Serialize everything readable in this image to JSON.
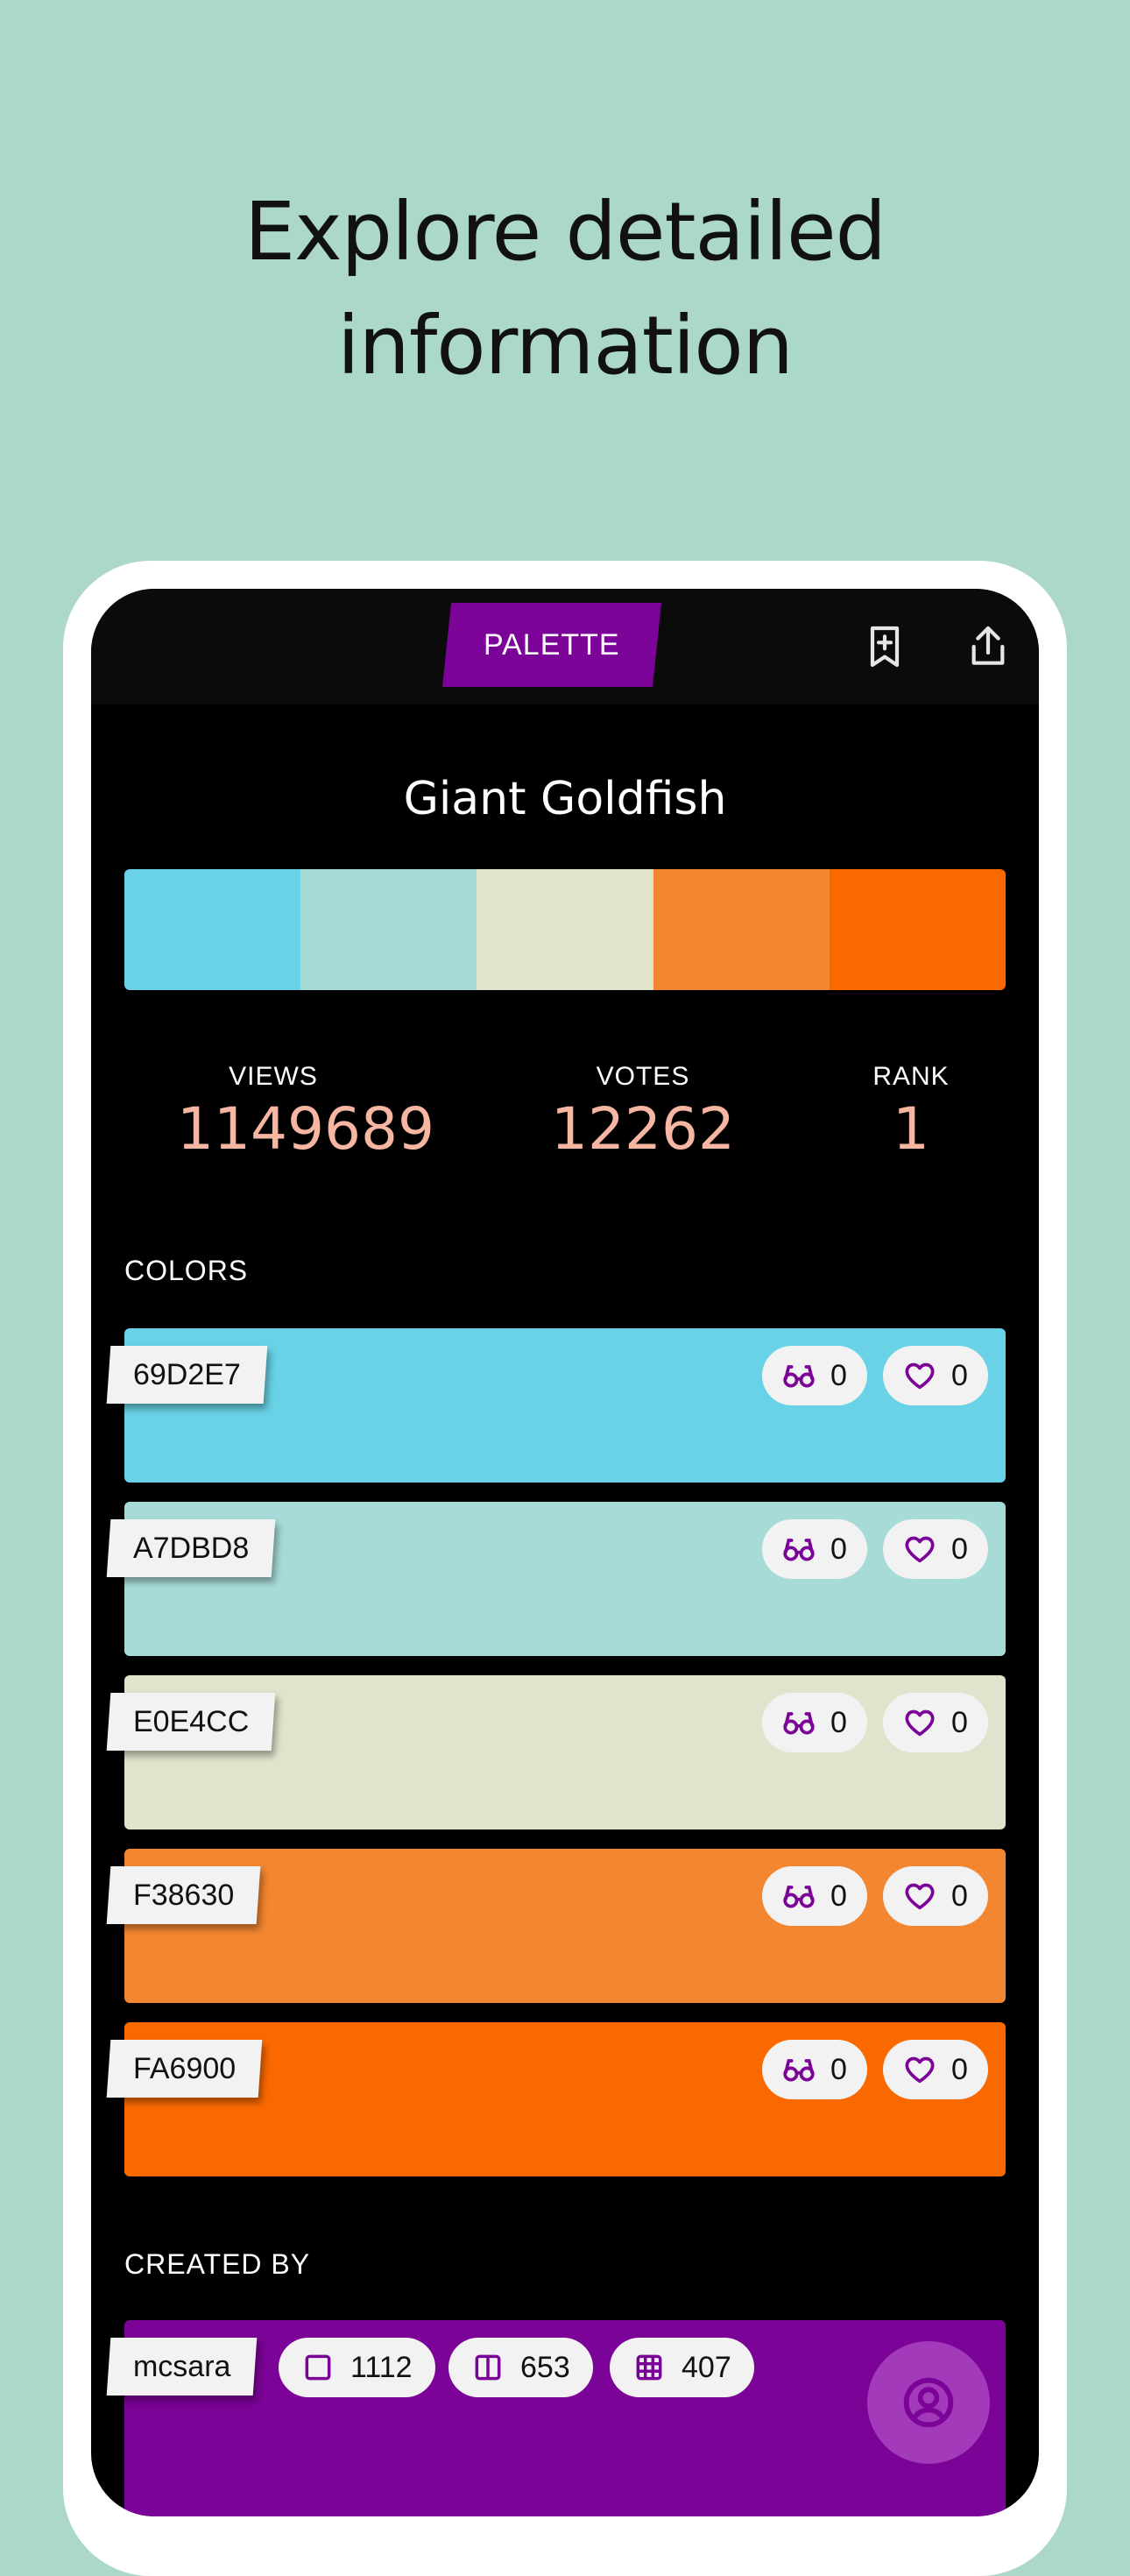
{
  "headline": {
    "line1": "Explore detailed",
    "line2": "information"
  },
  "topbar": {
    "tab_label": "PALETTE",
    "bookmark_icon": "bookmark-add-icon",
    "share_icon": "share-icon"
  },
  "palette": {
    "title": "Giant Goldfish",
    "colors": [
      "#69D2E7",
      "#A7DBD8",
      "#E0E4CC",
      "#F38630",
      "#FA6900"
    ]
  },
  "stats": {
    "views": {
      "label": "VIEWS",
      "value": "1149689"
    },
    "votes": {
      "label": "VOTES",
      "value": "12262"
    },
    "rank": {
      "label": "RANK",
      "value": "1"
    }
  },
  "colors_section": {
    "label": "COLORS",
    "items": [
      {
        "hex": "69D2E7",
        "color": "#69D2E7",
        "views": "0",
        "likes": "0"
      },
      {
        "hex": "A7DBD8",
        "color": "#A7DBD8",
        "views": "0",
        "likes": "0"
      },
      {
        "hex": "E0E4CC",
        "color": "#E0E4CC",
        "views": "0",
        "likes": "0"
      },
      {
        "hex": "F38630",
        "color": "#F38630",
        "views": "0",
        "likes": "0"
      },
      {
        "hex": "FA6900",
        "color": "#FA6900",
        "views": "0",
        "likes": "0"
      }
    ]
  },
  "creator": {
    "label": "CREATED BY",
    "username": "mcsara",
    "colors_count": "1112",
    "palettes_count": "653",
    "patterns_count": "407"
  },
  "accent_color": "#7B0397",
  "stat_color": "#F6B6A1"
}
